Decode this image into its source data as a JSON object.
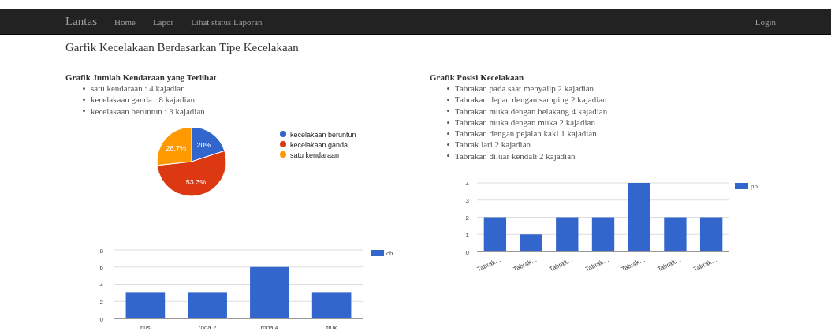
{
  "navbar": {
    "brand": "Lantas",
    "links": [
      "Home",
      "Lapor",
      "Lihat status Laporan"
    ],
    "login": "Login"
  },
  "page_title": "Garfik Kecelakaan Berdasarkan Tipe Kecelakaan",
  "left": {
    "heading": "Grafik Jumlah Kendaraan yang Terlibat",
    "items": [
      "satu kendaraan : 4 kajadian",
      "kecelakaan ganda : 8 kajadian",
      "kecelakaan beruntun : 3 kajadian"
    ],
    "pie": {
      "chart_data": {
        "type": "pie",
        "categories": [
          "kecelakaan beruntun",
          "kecelakaan ganda",
          "satu kendaraan"
        ],
        "series": [
          {
            "values": [
              20,
              53.3,
              26.7
            ],
            "colors": [
              "#3366cc",
              "#dc3912",
              "#ff9900"
            ]
          }
        ],
        "value_labels": [
          "20%",
          "53.3%",
          "26.7%"
        ],
        "legend": "right"
      }
    },
    "bar": {
      "chart_data": {
        "type": "bar",
        "categories": [
          "bus",
          "roda 2",
          "roda 4",
          "truk"
        ],
        "series": [
          {
            "name": "ch…",
            "color": "#3366cc",
            "values": [
              3,
              3,
              6,
              3
            ]
          }
        ],
        "ylim": [
          0,
          8
        ],
        "yticks": [
          0,
          2,
          4,
          6,
          8
        ],
        "grid": true
      }
    }
  },
  "right": {
    "heading": "Grafik Posisi Kecelakaan",
    "items": [
      "Tabrakan pada saat menyalip 2 kajadian",
      "Tabrakan depan dengan samping 2 kajadian",
      "Tabrakan muka dengan belakang 4 kajadian",
      "Tabrakan muka dengan muka 2 kajadian",
      "Tabrakan dengan pejalan kaki 1 kajadian",
      "Tabrak lari 2 kajadian",
      "Tabrakan diluar kendali 2 kajadian"
    ],
    "bar": {
      "chart_data": {
        "type": "bar",
        "categories": [
          "Tabrak…",
          "Tabrak…",
          "Tabrak…",
          "Tabrak…",
          "Tabrak…",
          "Tabrak…",
          "Tabrak…"
        ],
        "series": [
          {
            "name": "po…",
            "color": "#3366cc",
            "values": [
              2,
              1,
              2,
              2,
              4,
              2,
              2
            ]
          }
        ],
        "ylim": [
          0,
          4
        ],
        "yticks": [
          0,
          1,
          2,
          3,
          4
        ],
        "grid": true
      }
    }
  }
}
